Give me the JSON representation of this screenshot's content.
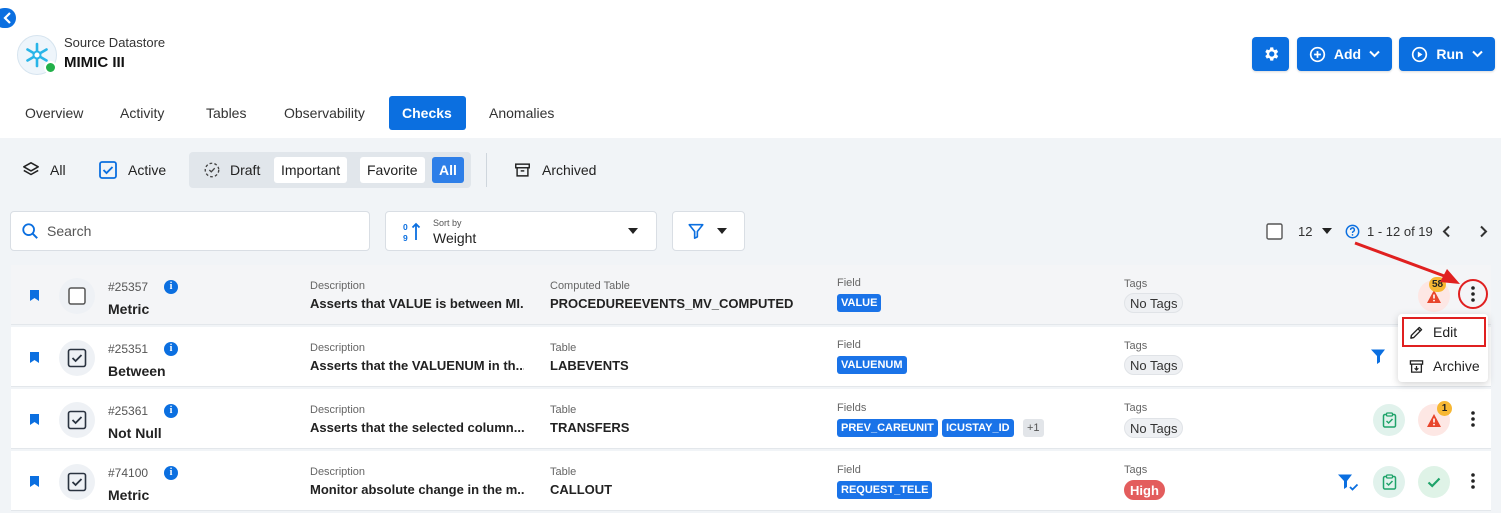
{
  "header": {
    "subtitle": "Source Datastore",
    "title": "MIMIC III",
    "add_label": "Add",
    "run_label": "Run"
  },
  "tabs": [
    {
      "label": "Overview"
    },
    {
      "label": "Activity"
    },
    {
      "label": "Tables"
    },
    {
      "label": "Observability"
    },
    {
      "label": "Checks",
      "active": true
    },
    {
      "label": "Anomalies"
    }
  ],
  "filters": {
    "all": "All",
    "active": "Active",
    "draft": "Draft",
    "important": "Important",
    "favorite": "Favorite",
    "all_selected": "All",
    "archived": "Archived"
  },
  "search": {
    "placeholder": "Search"
  },
  "sort": {
    "label": "Sort by",
    "value": "Weight"
  },
  "pager": {
    "per_page": "12",
    "range": "1 - 12 of 19"
  },
  "rows": [
    {
      "id": "#25357",
      "type": "Metric",
      "desc_label": "Description",
      "desc": "Asserts that VALUE is between MI...",
      "table_label": "Computed Table",
      "table": "PROCEDUREEVENTS_MV_COMPUTED",
      "field_label": "Field",
      "fields": [
        "VALUE"
      ],
      "tags_label": "Tags",
      "tag": "No Tags",
      "anomaly_count": "58"
    },
    {
      "id": "#25351",
      "type": "Between",
      "desc_label": "Description",
      "desc": "Asserts that the VALUENUM in th...",
      "table_label": "Table",
      "table": "LABEVENTS",
      "field_label": "Field",
      "fields": [
        "VALUENUM"
      ],
      "tags_label": "Tags",
      "tag": "No Tags"
    },
    {
      "id": "#25361",
      "type": "Not Null",
      "desc_label": "Description",
      "desc": "Asserts that the selected column...",
      "table_label": "Table",
      "table": "TRANSFERS",
      "field_label": "Fields",
      "fields": [
        "PREV_CAREUNIT",
        "ICUSTAY_ID"
      ],
      "more": "+1",
      "tags_label": "Tags",
      "tag": "No Tags",
      "anomaly_count": "1"
    },
    {
      "id": "#74100",
      "type": "Metric",
      "desc_label": "Description",
      "desc": "Monitor absolute change in the m...",
      "table_label": "Table",
      "table": "CALLOUT",
      "field_label": "Field",
      "fields": [
        "REQUEST_TELE"
      ],
      "tags_label": "Tags",
      "tag": "High"
    }
  ],
  "menu": {
    "edit": "Edit",
    "archive": "Archive"
  },
  "colors": {
    "accent": "#0b6fe0",
    "highlight": "#e02020",
    "high_tag": "#e35d5d",
    "badge": "#f7b733"
  }
}
